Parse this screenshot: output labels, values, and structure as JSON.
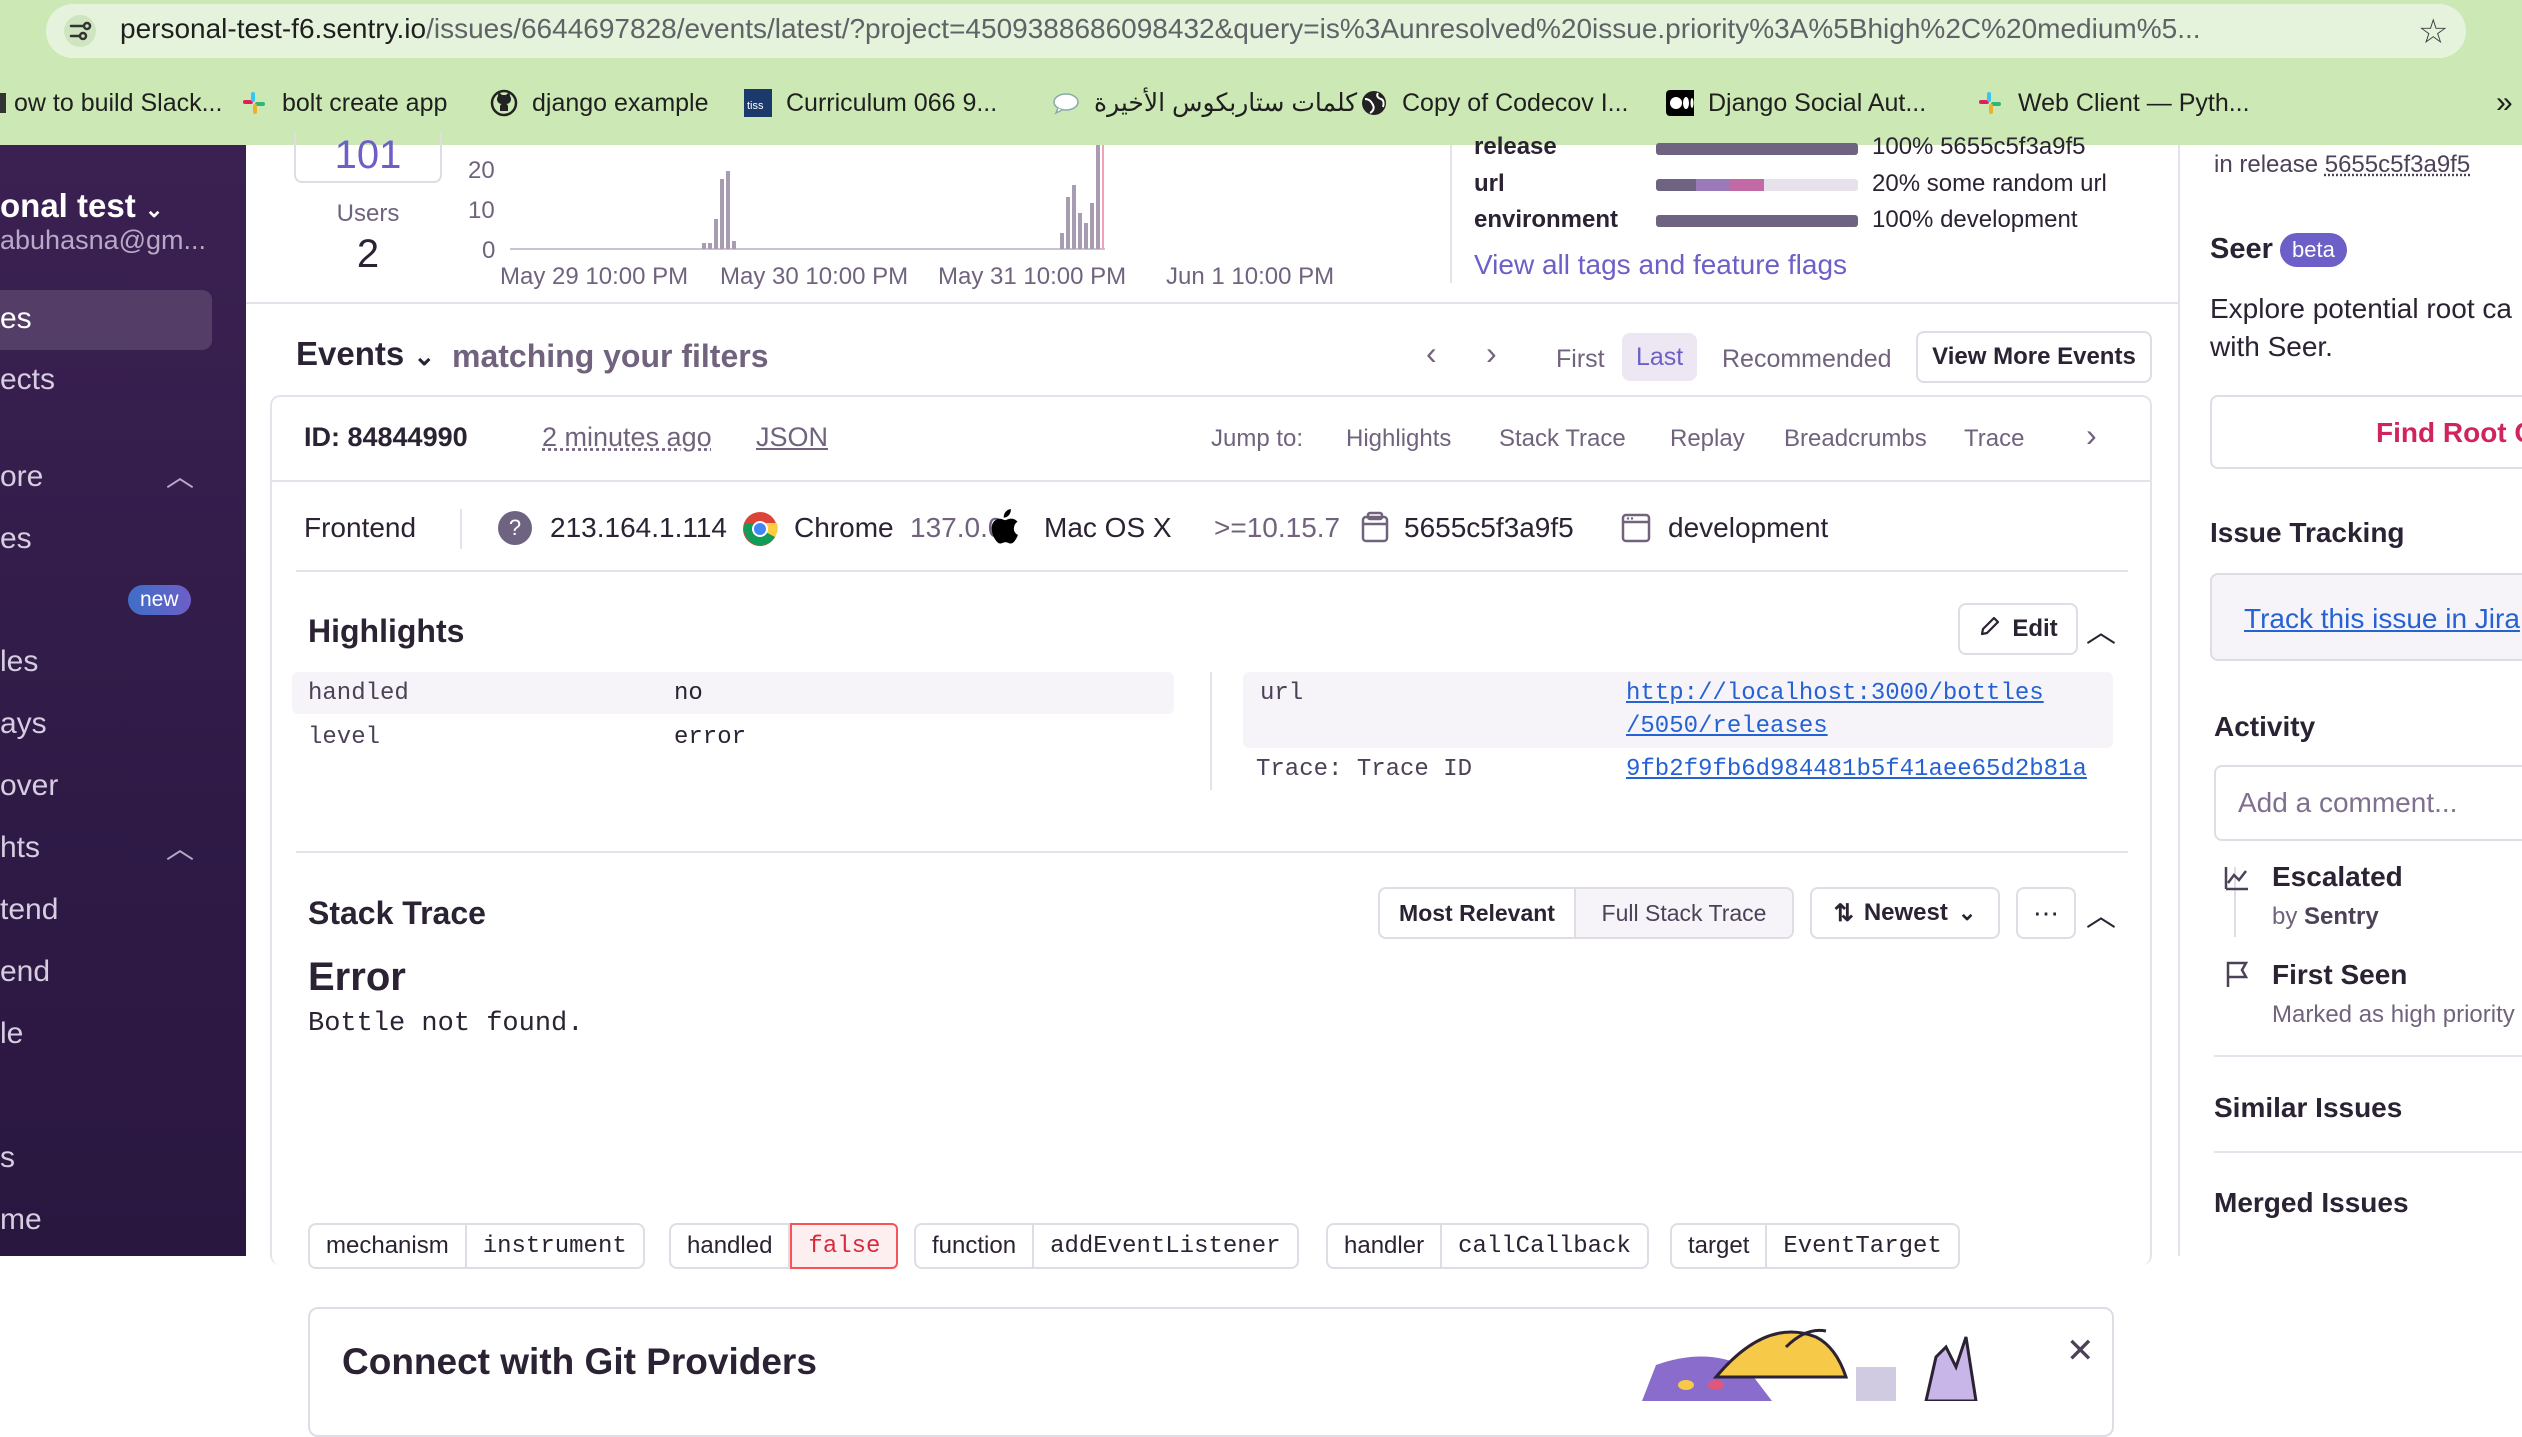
{
  "browser": {
    "url_host": "personal-test-f6.sentry.io",
    "url_rest": "/issues/6644697828/events/latest/?project=4509388686098432&query=is%3Aunresolved%20issue.priority%3A%5Bhigh%2C%20medium%5...",
    "bookmarks": [
      {
        "label": "ow to build Slack...",
        "icon": "slack-icon"
      },
      {
        "label": "bolt create app",
        "icon": "slack-icon"
      },
      {
        "label": "django example",
        "icon": "github-icon"
      },
      {
        "label": "Curriculum 066 9...",
        "icon": "tiss-icon"
      },
      {
        "label": "كلمات ستاربكوس الأخيرة",
        "icon": "chat-icon"
      },
      {
        "label": "Copy of Codecov I...",
        "icon": "globe-icon"
      },
      {
        "label": "Django Social Aut...",
        "icon": "medium-icon"
      },
      {
        "label": "Web Client — Pyth...",
        "icon": "slack-icon"
      }
    ],
    "more": "»"
  },
  "sidebar": {
    "org_name": "onal test",
    "org_email": "abuhasna@gm...",
    "items": [
      "es",
      "ects",
      "ore",
      "es",
      "les",
      "ays",
      "over",
      "hts",
      "tend",
      "end",
      "le",
      "s",
      "me"
    ],
    "new_badge": "new"
  },
  "stats": {
    "events_count": "101",
    "users_label": "Users",
    "users_count": "2",
    "y_ticks": [
      "20",
      "10",
      "0"
    ],
    "x_ticks": [
      "May 29 10:00 PM",
      "May 30 10:00 PM",
      "May 31 10:00 PM",
      "Jun 1 10:00 PM"
    ]
  },
  "tags_summary": [
    {
      "key": "release",
      "pct": "100%",
      "value": "5655c5f3a9f5"
    },
    {
      "key": "url",
      "pct": "20%",
      "value": "some random url"
    },
    {
      "key": "environment",
      "pct": "100%",
      "value": "development"
    }
  ],
  "view_all_tags": "View all tags and feature flags",
  "events_header": {
    "title": "Events",
    "subtitle": "matching your filters",
    "first": "First",
    "last": "Last",
    "recommended": "Recommended",
    "view_more": "View More Events"
  },
  "event": {
    "id": "ID: 84844990",
    "time": "2 minutes ago",
    "json": "JSON",
    "jump_to": "Jump to:",
    "jump_links": [
      "Highlights",
      "Stack Trace",
      "Replay",
      "Breadcrumbs",
      "Trace"
    ],
    "platform": "Frontend",
    "ip": "213.164.1.114",
    "browser_name": "Chrome",
    "browser_version": "137.0.0",
    "os_name": "Mac OS X",
    "os_version": ">=10.15.7",
    "release": "5655c5f3a9f5",
    "environment": "development"
  },
  "highlights": {
    "title": "Highlights",
    "edit": "Edit",
    "left": [
      {
        "key": "handled",
        "value": "no"
      },
      {
        "key": "level",
        "value": "error"
      }
    ],
    "url_key": "url",
    "url_value_1": "http://localhost:3000/bottles",
    "url_value_2": "/5050/releases",
    "trace_key": "Trace: Trace ID",
    "trace_value": "9fb2f9fb6d984481b5f41aee65d2b81a"
  },
  "stack": {
    "title": "Stack Trace",
    "most_relevant": "Most Relevant",
    "full": "Full Stack Trace",
    "sort": "Newest",
    "error_type": "Error",
    "error_msg": "Bottle not found.",
    "tags": [
      {
        "k": "mechanism",
        "v": "instrument"
      },
      {
        "k": "handled",
        "v": "false"
      },
      {
        "k": "function",
        "v": "addEventListener"
      },
      {
        "k": "handler",
        "v": "callCallback"
      },
      {
        "k": "target",
        "v": "EventTarget"
      }
    ]
  },
  "git_banner": {
    "title": "Connect with Git Providers"
  },
  "right": {
    "in_release_prefix": "in release",
    "in_release_value": "5655c5f3a9f5",
    "seer": "Seer",
    "beta": "beta",
    "seer_desc_1": "Explore potential root ca",
    "seer_desc_2": "with Seer.",
    "find_root": "Find Root C",
    "issue_tracking": "Issue Tracking",
    "track_jira": "Track this issue in Jira",
    "activity": "Activity",
    "comment_placeholder": "Add a comment...",
    "escalated": "Escalated",
    "by": "by",
    "by_who": "Sentry",
    "first_seen": "First Seen",
    "marked": "Marked as high priority",
    "similar": "Similar Issues",
    "merged": "Merged Issues"
  },
  "colors": {
    "accent": "#6c5fc7",
    "sidebar": "#3b2152",
    "error_tag": "#f55459",
    "link": "#2562d4",
    "seer_badge": "#6c5fc7",
    "find_root_text": "#d1245f"
  }
}
